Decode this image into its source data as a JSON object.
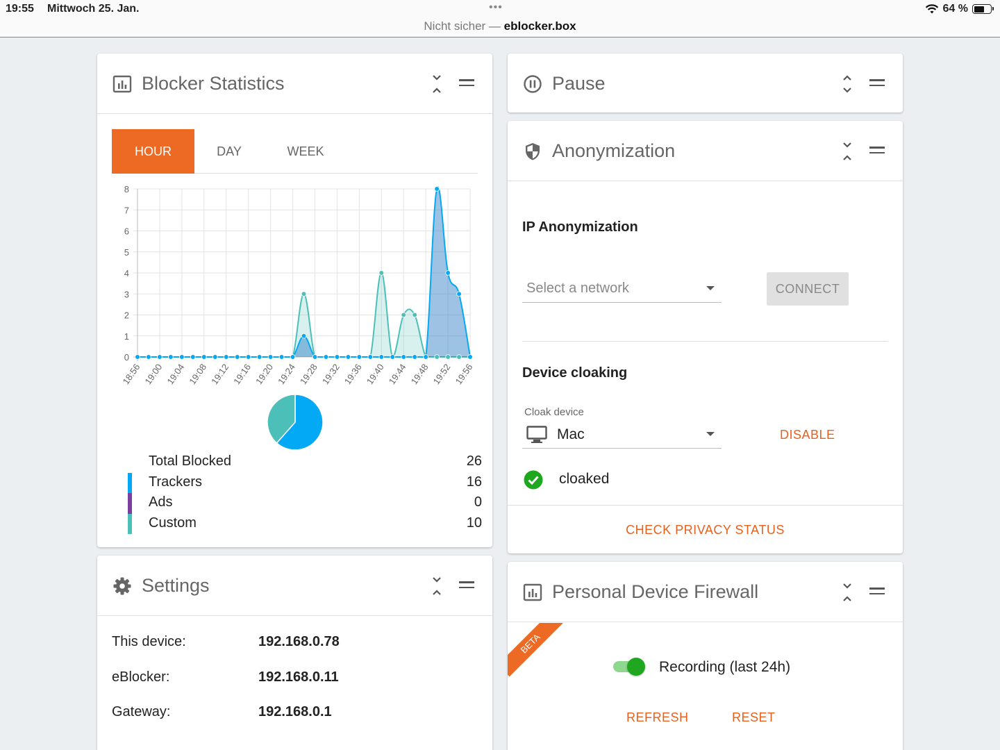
{
  "statusbar": {
    "time": "19:55",
    "date": "Mittwoch 25. Jan.",
    "dots": "•••",
    "security": "Nicht sicher — ",
    "host": "eblocker.box",
    "battery": "64 %"
  },
  "blocker": {
    "title": "Blocker Statistics",
    "tabs": [
      "HOUR",
      "DAY",
      "WEEK"
    ],
    "active_tab": "HOUR",
    "legend": [
      {
        "label": "Total Blocked",
        "value": "26",
        "color": "#ffffff"
      },
      {
        "label": "Trackers",
        "value": "16",
        "color": "#03a9f4"
      },
      {
        "label": "Ads",
        "value": "0",
        "color": "#7b3fa0"
      },
      {
        "label": "Custom",
        "value": "10",
        "color": "#4cc0b8"
      }
    ]
  },
  "chart_data": {
    "type": "area",
    "title": "",
    "xlabel": "",
    "ylabel": "",
    "ylim": [
      0,
      8
    ],
    "yticks": [
      0,
      1,
      2,
      3,
      4,
      5,
      6,
      7,
      8
    ],
    "xtick_labels": [
      "18:56",
      "19:00",
      "19:04",
      "19:08",
      "19:12",
      "19:16",
      "19:20",
      "19:24",
      "19:28",
      "19:32",
      "19:36",
      "19:40",
      "19:44",
      "19:48",
      "19:52",
      "19:56"
    ],
    "x": [
      "18:56",
      "18:58",
      "19:00",
      "19:02",
      "19:04",
      "19:06",
      "19:08",
      "19:10",
      "19:12",
      "19:14",
      "19:16",
      "19:18",
      "19:20",
      "19:22",
      "19:24",
      "19:26",
      "19:28",
      "19:30",
      "19:32",
      "19:34",
      "19:36",
      "19:38",
      "19:40",
      "19:42",
      "19:44",
      "19:46",
      "19:48",
      "19:50",
      "19:52",
      "19:54",
      "19:56"
    ],
    "series": [
      {
        "color": "#4cc0b8",
        "values": [
          0,
          0,
          0,
          0,
          0,
          0,
          0,
          0,
          0,
          0,
          0,
          0,
          0,
          0,
          0,
          3,
          0,
          0,
          0,
          0,
          0,
          0,
          4,
          0,
          2,
          2,
          0,
          0,
          0,
          0,
          0
        ]
      },
      {
        "color": "#03a9f4",
        "values": [
          0,
          0,
          0,
          0,
          0,
          0,
          0,
          0,
          0,
          0,
          0,
          0,
          0,
          0,
          0,
          1,
          0,
          0,
          0,
          0,
          0,
          0,
          0,
          0,
          0,
          0,
          0,
          8,
          4,
          3,
          0
        ]
      }
    ],
    "pie": [
      {
        "label": "Trackers",
        "value": 16,
        "color": "#03a9f4"
      },
      {
        "label": "Ads",
        "value": 0,
        "color": "#7b3fa0"
      },
      {
        "label": "Custom",
        "value": 10,
        "color": "#4cc0b8"
      }
    ]
  },
  "settings": {
    "title": "Settings",
    "rows": [
      {
        "label": "This device:",
        "value": "192.168.0.78"
      },
      {
        "label": "eBlocker:",
        "value": "192.168.0.11"
      },
      {
        "label": "Gateway:",
        "value": "192.168.0.1"
      }
    ]
  },
  "pause": {
    "title": "Pause"
  },
  "anonymization": {
    "title": "Anonymization",
    "ip_title": "IP Anonymization",
    "network_placeholder": "Select a network",
    "connect_label": "CONNECT",
    "cloak_title": "Device cloaking",
    "cloak_label": "Cloak device",
    "cloak_value": "Mac",
    "disable_label": "DISABLE",
    "status_text": "cloaked",
    "check_label": "CHECK PRIVACY STATUS"
  },
  "firewall": {
    "title": "Personal Device Firewall",
    "badge": "BETA",
    "recording_label": "Recording (last 24h)",
    "recording_on": true,
    "refresh_label": "REFRESH",
    "reset_label": "RESET"
  },
  "colors": {
    "accent": "#ec6a23",
    "trackers": "#03a9f4",
    "custom": "#4cc0b8",
    "ads": "#7b3fa0",
    "success": "#1fa81f"
  }
}
